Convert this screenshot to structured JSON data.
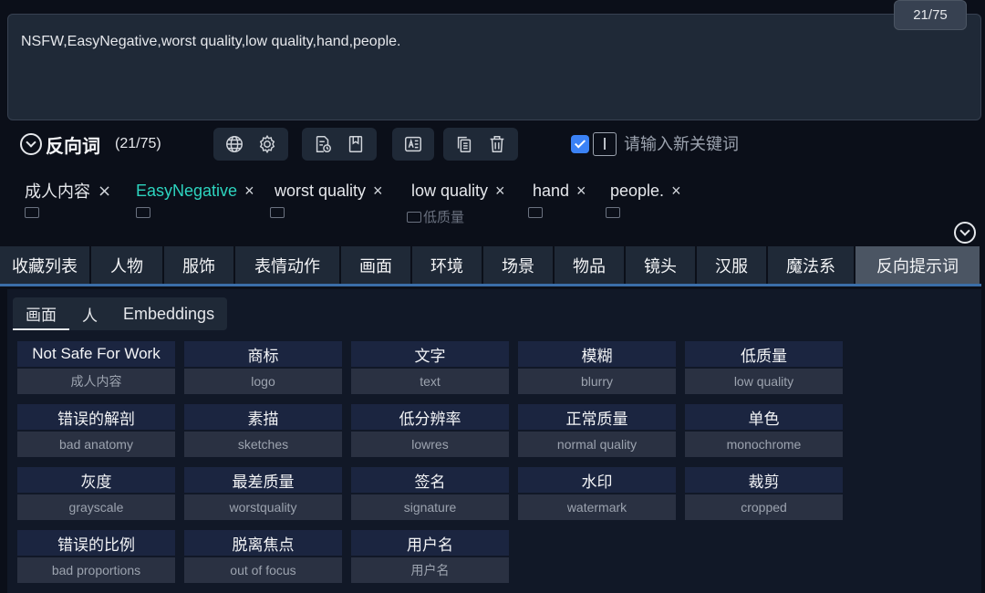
{
  "prompt": {
    "text": "NSFW,EasyNegative,worst quality,low quality,hand,people.",
    "token_counter": "21/75"
  },
  "negative": {
    "title": "反向词",
    "count": "(21/75)",
    "keyword_placeholder": "请输入新关键词",
    "keyword_checked": true
  },
  "tags": [
    {
      "label": "成人内容",
      "sub": ""
    },
    {
      "label": "EasyNegative",
      "sub": ""
    },
    {
      "label": "worst quality",
      "sub": ""
    },
    {
      "label": "low quality",
      "sub": "低质量"
    },
    {
      "label": "hand",
      "sub": ""
    },
    {
      "label": "people.",
      "sub": ""
    }
  ],
  "tag_remove_symbol": "×",
  "categories": [
    "收藏列表",
    "人物",
    "服饰",
    "表情动作",
    "画面",
    "环境",
    "场景",
    "物品",
    "镜头",
    "汉服",
    "魔法系",
    "反向提示词"
  ],
  "active_category": "反向提示词",
  "sub_tabs": [
    "画面",
    "人",
    "Embeddings"
  ],
  "active_sub_tab": "画面",
  "cards": [
    {
      "top": "Not Safe For Work",
      "bottom": "成人内容"
    },
    {
      "top": "商标",
      "bottom": "logo"
    },
    {
      "top": "文字",
      "bottom": "text"
    },
    {
      "top": "模糊",
      "bottom": "blurry"
    },
    {
      "top": "低质量",
      "bottom": "low quality"
    },
    {
      "top": "错误的解剖",
      "bottom": "bad anatomy"
    },
    {
      "top": "素描",
      "bottom": "sketches"
    },
    {
      "top": "低分辨率",
      "bottom": "lowres"
    },
    {
      "top": "正常质量",
      "bottom": "normal quality"
    },
    {
      "top": "单色",
      "bottom": "monochrome"
    },
    {
      "top": "灰度",
      "bottom": "grayscale"
    },
    {
      "top": "最差质量",
      "bottom": "worstquality"
    },
    {
      "top": "签名",
      "bottom": "signature"
    },
    {
      "top": "水印",
      "bottom": "watermark"
    },
    {
      "top": "裁剪",
      "bottom": "cropped"
    },
    {
      "top": "错误的比例",
      "bottom": "bad proportions"
    },
    {
      "top": "脱离焦点",
      "bottom": "out of focus"
    },
    {
      "top": "用户名",
      "bottom": "用户名"
    }
  ],
  "colors": {
    "background": "#0b0f19",
    "accent_tag": "#2dd4bf",
    "active_tab": "#4b5563",
    "checkbox": "#3b82f6",
    "tab_underline": "#3b6ea8"
  },
  "icons": {
    "collapse": "circle-chevron-down-icon",
    "toolbar": [
      "globe-icon",
      "gear-icon",
      "document-clock-icon",
      "bookmark-icon",
      "translate-icon",
      "copy-icon",
      "trash-icon"
    ],
    "cursor": "text-cursor-icon",
    "expand": "circle-chevron-down-icon"
  }
}
